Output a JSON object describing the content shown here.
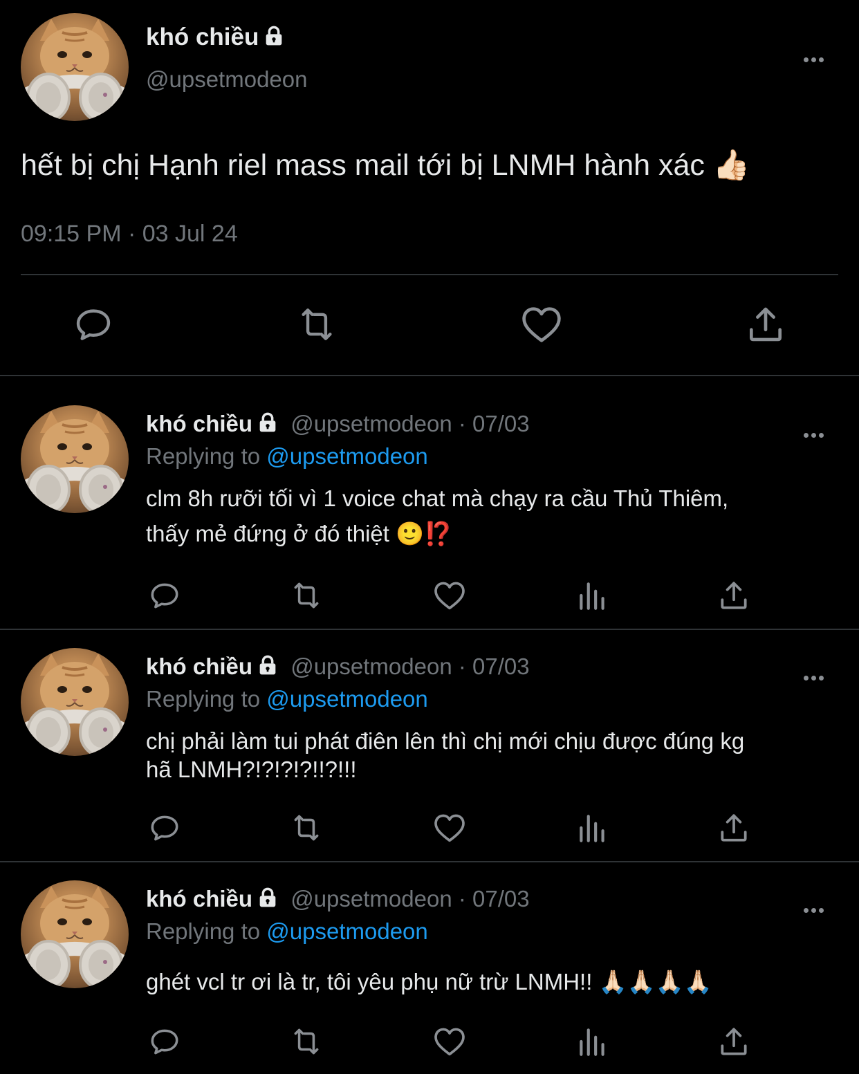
{
  "main_tweet": {
    "display_name": "khó chiều",
    "handle": "@upsetmodeon",
    "text": "hết bị chị Hạnh riel mass mail tới bị LNMH hành xác 👍🏻",
    "timestamp": "09:15 PM · 03 Jul 24"
  },
  "replies": [
    {
      "display_name": "khó chiều",
      "meta": "@upsetmodeon · 07/03",
      "replying_prefix": "Replying to",
      "replying_handle": "@upsetmodeon",
      "line1": "clm 8h rưỡi tối vì 1 voice chat mà chạy ra cầu Thủ Thiêm,",
      "line2": "thấy mẻ đứng ở đó thiệt 🙂⁉️"
    },
    {
      "display_name": "khó chiều",
      "meta": "@upsetmodeon · 07/03",
      "replying_prefix": "Replying to",
      "replying_handle": "@upsetmodeon",
      "line1": "chị phải làm tui phát điên lên thì chị mới chịu được đúng kg",
      "line2": "hã LNMH?!?!?!?!!?!!!"
    },
    {
      "display_name": "khó chiều",
      "meta": "@upsetmodeon · 07/03",
      "replying_prefix": "Replying to",
      "replying_handle": "@upsetmodeon",
      "line1": "ghét vcl tr ơi là tr, tôi yêu phụ nữ trừ LNMH!! 🙏🏻🙏🏻🙏🏻🙏🏻",
      "line2": ""
    }
  ],
  "icons": {
    "reply": "reply-icon",
    "retweet": "retweet-icon",
    "like": "like-icon",
    "views": "views-icon",
    "share": "share-icon",
    "more": "more-icon",
    "lock": "lock-icon"
  },
  "colors": {
    "background": "#000000",
    "text": "#e7e9ea",
    "muted": "#71767b",
    "link": "#1d9bf0",
    "divider": "#2f3336"
  }
}
